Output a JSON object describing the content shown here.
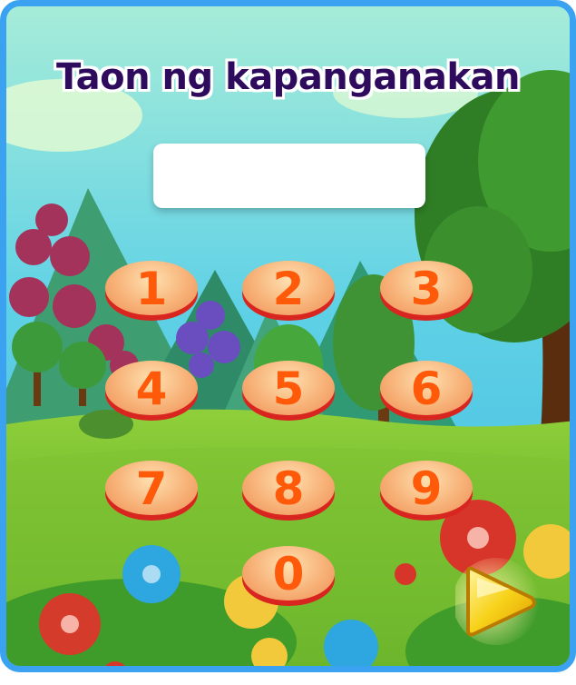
{
  "title": "Taon ng kapanganakan",
  "year_input": {
    "value": ""
  },
  "keys": [
    {
      "digit": "1"
    },
    {
      "digit": "2"
    },
    {
      "digit": "3"
    },
    {
      "digit": "4"
    },
    {
      "digit": "5"
    },
    {
      "digit": "6"
    },
    {
      "digit": "7"
    },
    {
      "digit": "8"
    },
    {
      "digit": "9"
    },
    {
      "digit": "0"
    }
  ],
  "colors": {
    "frame": "#3aa2f0",
    "title_text": "#2e0b5c",
    "key_digit": "#ff5a0a",
    "key_base": "#d8251f",
    "next_arrow": "#f7d21a"
  },
  "icons": {
    "next": "yellow-play-arrow-icon"
  }
}
